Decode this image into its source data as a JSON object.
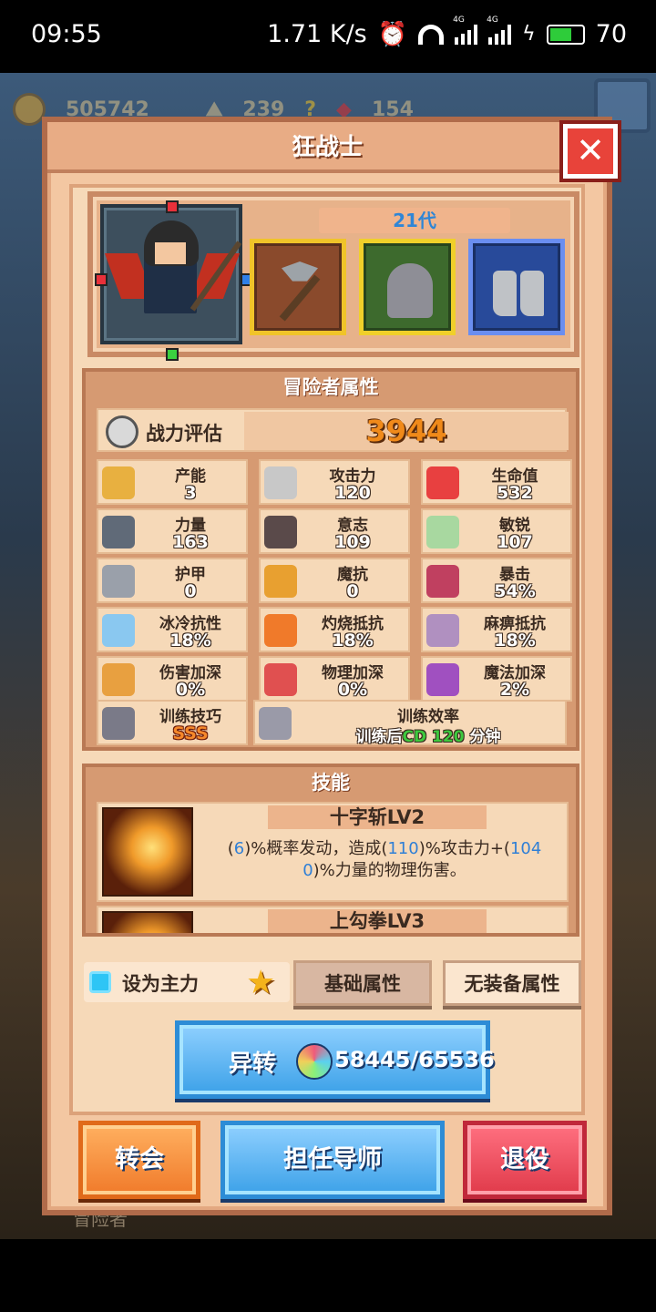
{
  "status_bar": {
    "time": "09:55",
    "speed": "1.71 K/s",
    "net1": "4G",
    "net2": "4G",
    "battery": "70"
  },
  "resources": {
    "gold": "505742",
    "item2": "239",
    "item3": "154"
  },
  "dialog": {
    "title": "狂战士",
    "close_icon": "close-icon",
    "generation": "21代",
    "attributes": {
      "title": "冒险者属性",
      "power_label": "战力评估",
      "power_value": "3944",
      "rows": [
        [
          {
            "label": "产能",
            "value": "3",
            "icon": "crystal-icon",
            "color": "#e8b040"
          },
          {
            "label": "攻击力",
            "value": "120",
            "icon": "sword-icon",
            "color": "#c8c8c8"
          },
          {
            "label": "生命值",
            "value": "532",
            "icon": "red-cross-icon",
            "color": "#e84040"
          }
        ],
        [
          {
            "label": "力量",
            "value": "163",
            "icon": "anvil-icon",
            "color": "#606a78"
          },
          {
            "label": "意志",
            "value": "109",
            "icon": "statue-icon",
            "color": "#5a4a4a"
          },
          {
            "label": "敏锐",
            "value": "107",
            "icon": "wings-icon",
            "color": "#a8d8a0"
          }
        ],
        [
          {
            "label": "护甲",
            "value": "0",
            "icon": "armor-plate-icon",
            "color": "#9aa0aa"
          },
          {
            "label": "魔抗",
            "value": "0",
            "icon": "magic-shield-icon",
            "color": "#e8a030"
          },
          {
            "label": "暴击",
            "value": "54%",
            "icon": "crossed-swords-icon",
            "color": "#c04060"
          }
        ],
        [
          {
            "label": "冰冷抗性",
            "value": "18%",
            "icon": "ice-icon",
            "color": "#8ac8f0"
          },
          {
            "label": "灼烧抵抗",
            "value": "18%",
            "icon": "fire-icon",
            "color": "#f07a2a"
          },
          {
            "label": "麻痹抵抗",
            "value": "18%",
            "icon": "paralysis-icon",
            "color": "#b090c0"
          }
        ],
        [
          {
            "label": "伤害加深",
            "value": "0%",
            "icon": "claw-icon",
            "color": "#e8a040"
          },
          {
            "label": "物理加深",
            "value": "0%",
            "icon": "heart-axe-icon",
            "color": "#e05050"
          },
          {
            "label": "魔法加深",
            "value": "2%",
            "icon": "wand-icon",
            "color": "#a050c0"
          }
        ]
      ],
      "training_skill_label": "训练技巧",
      "training_skill_value": "SSS",
      "training_eff_label": "训练效率",
      "training_eff_prefix": "训练后",
      "training_eff_cd": "CD",
      "training_eff_num": "120",
      "training_eff_unit": "分钟"
    },
    "skills": {
      "title": "技能",
      "items": [
        {
          "name": "十字斩LV2",
          "desc_parts": [
            "(",
            "6",
            ")%概率发动，造成(",
            "110",
            ")%攻击力+(",
            "104",
            "0",
            ")%力量的物理伤害。"
          ]
        },
        {
          "name": "上勾拳LV3"
        }
      ]
    },
    "main_toggle": "设为主力",
    "tabs": {
      "basic": "基础属性",
      "no_equip": "无装备属性"
    },
    "transform": {
      "label": "异转",
      "count": "58445/65536"
    },
    "buttons": {
      "reroll": "转会",
      "mentor": "担任导师",
      "retire": "退役"
    }
  },
  "background": {
    "bottom_tab": "冒险者"
  }
}
